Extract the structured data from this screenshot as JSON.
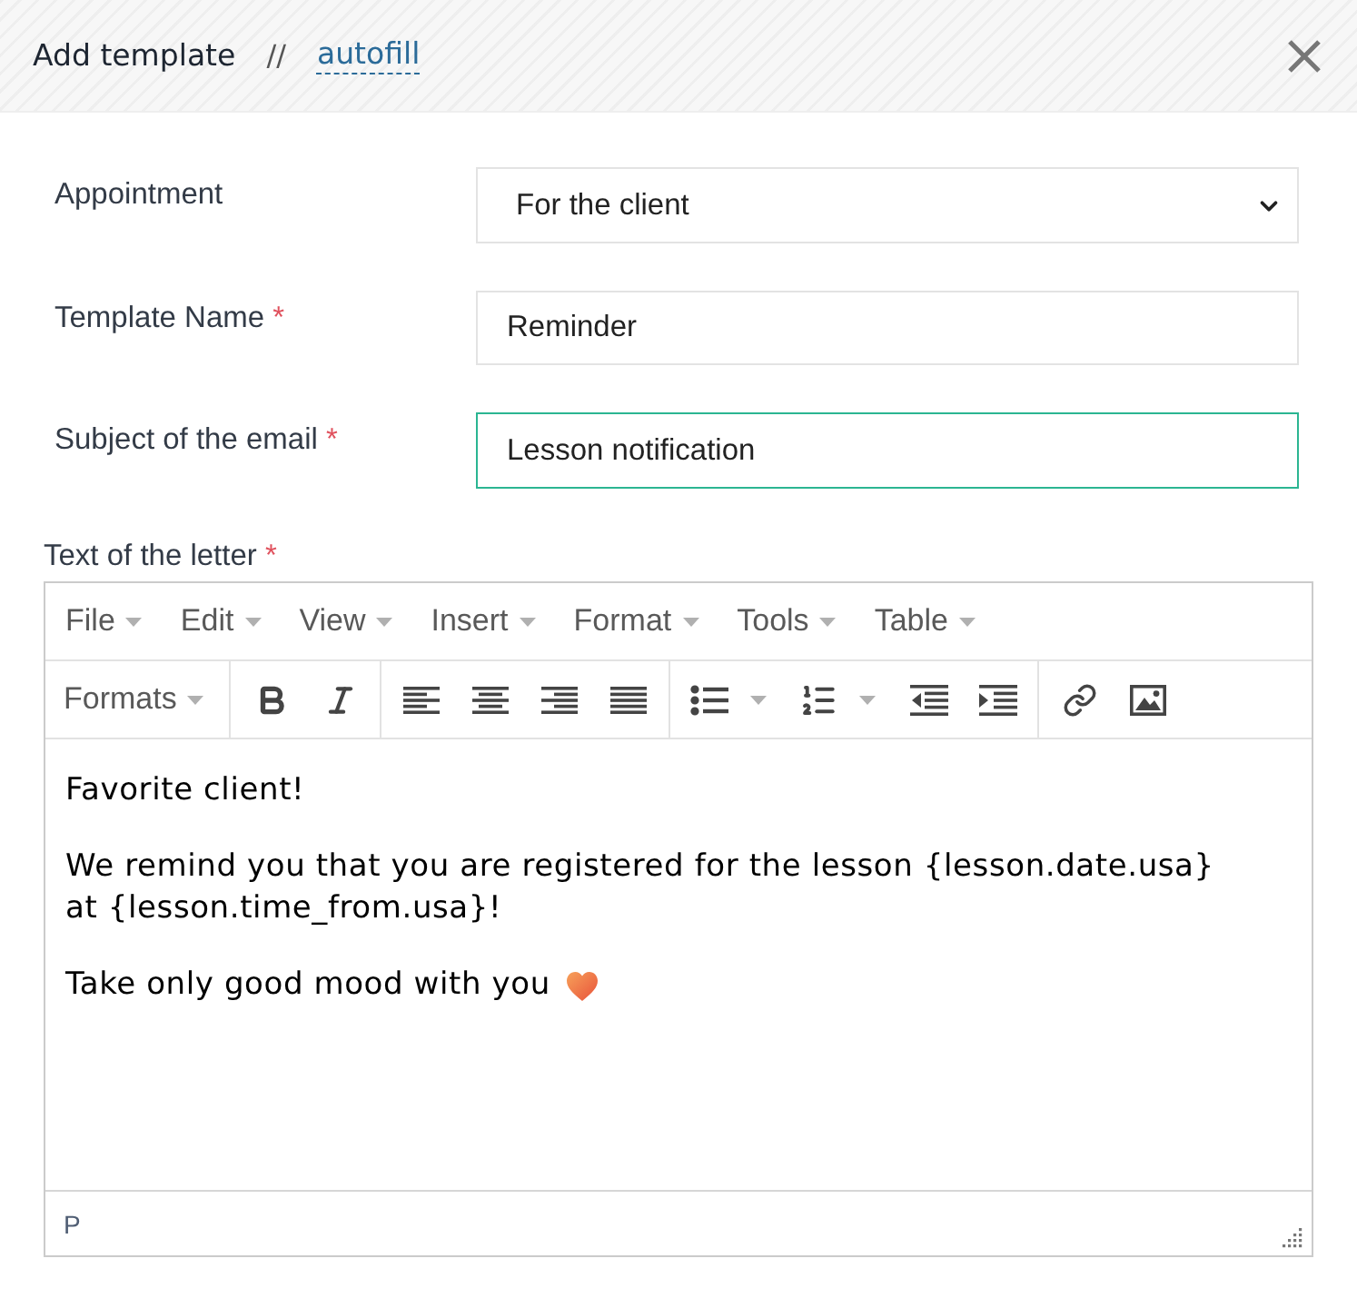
{
  "header": {
    "title": "Add template",
    "separator": "//",
    "link": "autofill"
  },
  "fields": [
    {
      "kind": "select",
      "label": "Appointment",
      "value": "For the client",
      "focused": false
    },
    {
      "kind": "input",
      "label": "Template Name",
      "required_mark": "*",
      "value": "Reminder",
      "focused": false
    },
    {
      "kind": "input",
      "label": "Subject of the email",
      "required_mark": "*",
      "value": "Lesson notification",
      "focused": true
    }
  ],
  "editor": {
    "label": "Text of the letter",
    "required_mark": "*",
    "menu": [
      "File",
      "Edit",
      "View",
      "Insert",
      "Format",
      "Tools",
      "Table"
    ],
    "formats": "Formats",
    "paragraphs": [
      {
        "lines": [
          "Favorite client!"
        ],
        "emoji": false
      },
      {
        "lines": [
          "We remind you that you are registered for the lesson {lesson.date.usa}",
          "at {lesson.time_from.usa}!"
        ],
        "emoji": false
      },
      {
        "lines": [
          "Take only good mood with you"
        ],
        "emoji": true
      }
    ],
    "path": "P"
  }
}
